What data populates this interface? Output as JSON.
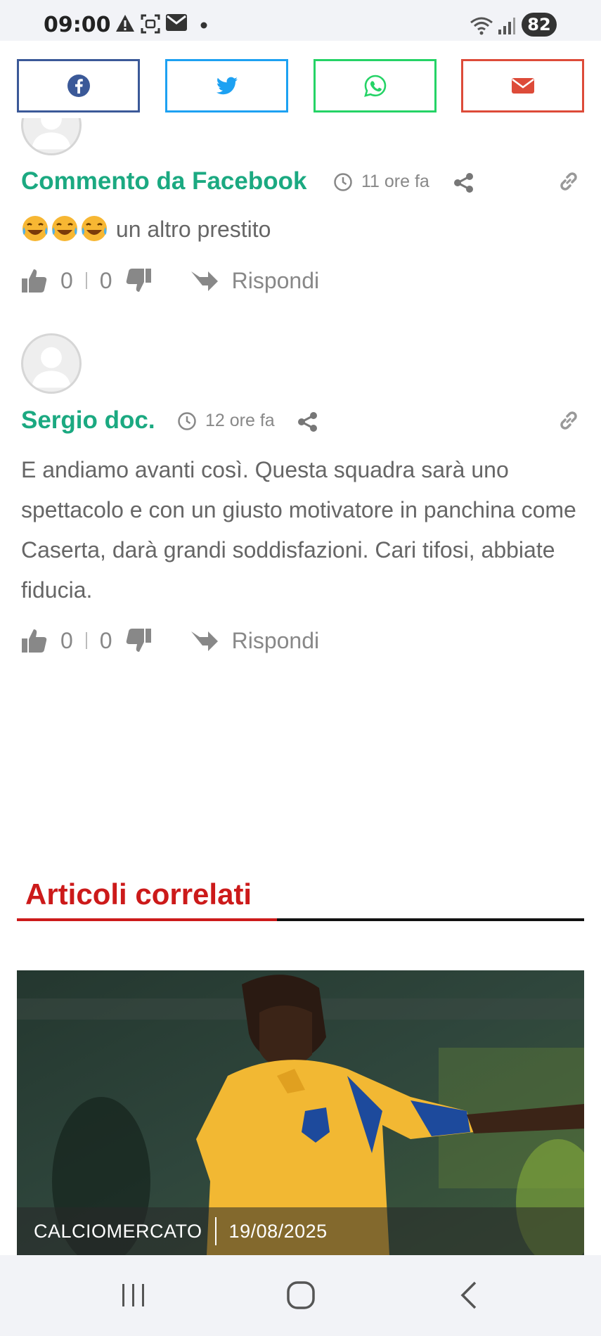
{
  "status_bar": {
    "time": "09:00",
    "battery": "82",
    "icons": [
      "alert-icon",
      "screenshot-icon",
      "mail-icon",
      "dot-icon",
      "wifi-icon",
      "signal-icon"
    ]
  },
  "ghost_row": {
    "likes": "0",
    "dislikes": "0",
    "reply": "Rispondi"
  },
  "share": {
    "buttons": [
      "facebook",
      "twitter",
      "whatsapp",
      "email"
    ],
    "colors": {
      "facebook": "#3b5998",
      "twitter": "#1da1f2",
      "whatsapp": "#25d366",
      "email": "#dd4b39"
    }
  },
  "comments": [
    {
      "author": "Commento da Facebook",
      "time": "11 ore fa",
      "text": "un altro prestito",
      "emoji": [
        "joy",
        "joy",
        "joy"
      ],
      "likes": "0",
      "dislikes": "0",
      "reply": "Rispondi"
    },
    {
      "author": "Sergio doc.",
      "time": "12 ore fa",
      "text": "E andiamo avanti così. Questa squadra sarà uno spettacolo e con un giusto motivatore in panchina come Caserta, darà grandi soddisfazioni. Cari tifosi, abbiate fiducia.",
      "likes": "0",
      "dislikes": "0",
      "reply": "Rispondi"
    }
  ],
  "related": {
    "title": "Articoli correlati",
    "card": {
      "category": "CALCIOMERCATO",
      "date": "19/08/2025"
    }
  },
  "colors": {
    "author": "#1ba981",
    "related_accent": "#cc1a1a"
  }
}
